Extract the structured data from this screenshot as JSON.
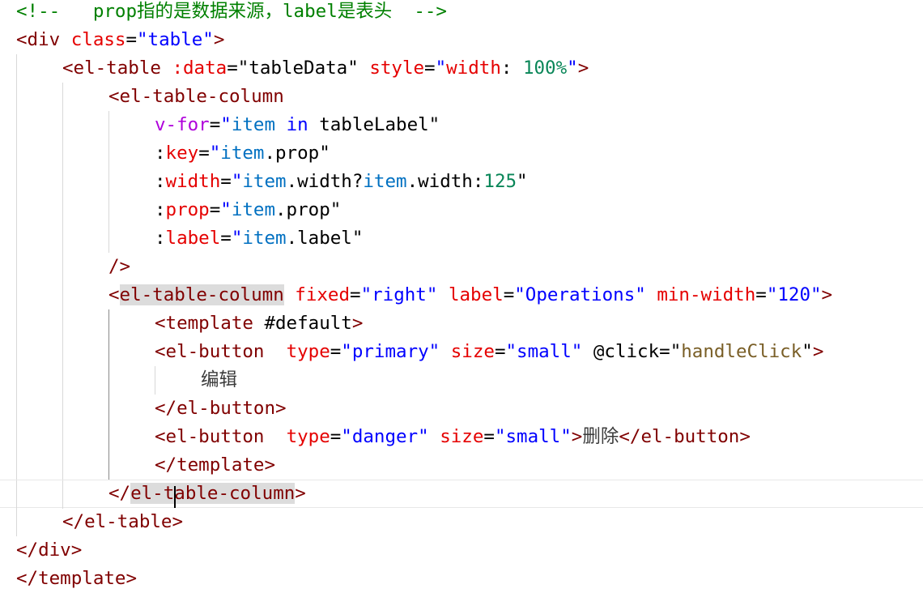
{
  "editor": {
    "lines": [
      {
        "indent": 0,
        "guides": [],
        "tokens": [
          {
            "t": "<!--",
            "c": "comment"
          },
          {
            "t": "   prop指的是数据来源，label是表头",
            "c": "comment"
          },
          {
            "t": "  -->",
            "c": "comment"
          }
        ]
      },
      {
        "indent": 0,
        "guides": [],
        "tokens": [
          {
            "t": "<",
            "c": "punct"
          },
          {
            "t": "div",
            "c": "tag"
          },
          {
            "t": " ",
            "c": "plain"
          },
          {
            "t": "class",
            "c": "attr"
          },
          {
            "t": "=",
            "c": "plain"
          },
          {
            "t": "\"table\"",
            "c": "str"
          },
          {
            "t": ">",
            "c": "punct"
          }
        ]
      },
      {
        "indent": 2,
        "guides": [
          0
        ],
        "tokens": [
          {
            "t": "<",
            "c": "punct"
          },
          {
            "t": "el-table",
            "c": "tag"
          },
          {
            "t": " ",
            "c": "plain"
          },
          {
            "t": ":data",
            "c": "attr"
          },
          {
            "t": "=",
            "c": "plain"
          },
          {
            "t": "\"tableData\"",
            "c": "plain"
          },
          {
            "t": " ",
            "c": "plain"
          },
          {
            "t": "style",
            "c": "attr"
          },
          {
            "t": "=",
            "c": "plain"
          },
          {
            "t": "\"",
            "c": "str"
          },
          {
            "t": "width",
            "c": "attr"
          },
          {
            "t": ": ",
            "c": "plain"
          },
          {
            "t": "100%",
            "c": "num"
          },
          {
            "t": "\"",
            "c": "str"
          },
          {
            "t": ">",
            "c": "punct"
          }
        ]
      },
      {
        "indent": 4,
        "guides": [
          0,
          2
        ],
        "tokens": [
          {
            "t": "<",
            "c": "punct"
          },
          {
            "t": "el-table-column",
            "c": "tag"
          }
        ]
      },
      {
        "indent": 6,
        "guides": [
          0,
          2,
          4
        ],
        "tokens": [
          {
            "t": "v-for",
            "c": "dir"
          },
          {
            "t": "=",
            "c": "plain"
          },
          {
            "t": "\"",
            "c": "str"
          },
          {
            "t": "item",
            "c": "var"
          },
          {
            "t": " ",
            "c": "plain"
          },
          {
            "t": "in",
            "c": "kw"
          },
          {
            "t": " tableLabel",
            "c": "plain"
          },
          {
            "t": "\"",
            "c": "plain"
          }
        ]
      },
      {
        "indent": 6,
        "guides": [
          0,
          2,
          4
        ],
        "tokens": [
          {
            "t": ":",
            "c": "plain"
          },
          {
            "t": "key",
            "c": "attr"
          },
          {
            "t": "=",
            "c": "plain"
          },
          {
            "t": "\"",
            "c": "str"
          },
          {
            "t": "item",
            "c": "var"
          },
          {
            "t": ".prop",
            "c": "plain"
          },
          {
            "t": "\"",
            "c": "plain"
          }
        ]
      },
      {
        "indent": 6,
        "guides": [
          0,
          2,
          4
        ],
        "tokens": [
          {
            "t": ":",
            "c": "plain"
          },
          {
            "t": "width",
            "c": "attr"
          },
          {
            "t": "=",
            "c": "plain"
          },
          {
            "t": "\"",
            "c": "str"
          },
          {
            "t": "item",
            "c": "var"
          },
          {
            "t": ".width?",
            "c": "plain"
          },
          {
            "t": "item",
            "c": "var"
          },
          {
            "t": ".width:",
            "c": "plain"
          },
          {
            "t": "125",
            "c": "num"
          },
          {
            "t": "\"",
            "c": "plain"
          }
        ]
      },
      {
        "indent": 6,
        "guides": [
          0,
          2,
          4
        ],
        "tokens": [
          {
            "t": ":",
            "c": "plain"
          },
          {
            "t": "prop",
            "c": "attr"
          },
          {
            "t": "=",
            "c": "plain"
          },
          {
            "t": "\"",
            "c": "str"
          },
          {
            "t": "item",
            "c": "var"
          },
          {
            "t": ".prop",
            "c": "plain"
          },
          {
            "t": "\"",
            "c": "plain"
          }
        ]
      },
      {
        "indent": 6,
        "guides": [
          0,
          2,
          4
        ],
        "tokens": [
          {
            "t": ":",
            "c": "plain"
          },
          {
            "t": "label",
            "c": "attr"
          },
          {
            "t": "=",
            "c": "plain"
          },
          {
            "t": "\"",
            "c": "str"
          },
          {
            "t": "item",
            "c": "var"
          },
          {
            "t": ".label",
            "c": "plain"
          },
          {
            "t": "\"",
            "c": "plain"
          }
        ]
      },
      {
        "indent": 4,
        "guides": [
          0,
          2
        ],
        "tokens": [
          {
            "t": "/>",
            "c": "punct"
          }
        ]
      },
      {
        "indent": 4,
        "guides": [
          0,
          2
        ],
        "tokens": [
          {
            "t": "<",
            "c": "punct"
          },
          {
            "t": "el-table-column",
            "c": "tag",
            "hl": true
          },
          {
            "t": " ",
            "c": "plain"
          },
          {
            "t": "fixed",
            "c": "attr"
          },
          {
            "t": "=",
            "c": "plain"
          },
          {
            "t": "\"right\"",
            "c": "str"
          },
          {
            "t": " ",
            "c": "plain"
          },
          {
            "t": "label",
            "c": "attr"
          },
          {
            "t": "=",
            "c": "plain"
          },
          {
            "t": "\"Operations\"",
            "c": "str"
          },
          {
            "t": " ",
            "c": "plain"
          },
          {
            "t": "min-width",
            "c": "attr"
          },
          {
            "t": "=",
            "c": "plain"
          },
          {
            "t": "\"120\"",
            "c": "str"
          },
          {
            "t": ">",
            "c": "punct"
          }
        ]
      },
      {
        "indent": 6,
        "guides": [
          0,
          2,
          4
        ],
        "active": 4,
        "tokens": [
          {
            "t": "<",
            "c": "punct"
          },
          {
            "t": "template",
            "c": "tag"
          },
          {
            "t": " #default",
            "c": "plain"
          },
          {
            "t": ">",
            "c": "punct"
          }
        ]
      },
      {
        "indent": 6,
        "guides": [
          0,
          2,
          4
        ],
        "active": 4,
        "tokens": [
          {
            "t": "<",
            "c": "punct"
          },
          {
            "t": "el-button",
            "c": "tag"
          },
          {
            "t": "  ",
            "c": "plain"
          },
          {
            "t": "type",
            "c": "attr"
          },
          {
            "t": "=",
            "c": "plain"
          },
          {
            "t": "\"primary\"",
            "c": "str"
          },
          {
            "t": " ",
            "c": "plain"
          },
          {
            "t": "size",
            "c": "attr"
          },
          {
            "t": "=",
            "c": "plain"
          },
          {
            "t": "\"small\"",
            "c": "str"
          },
          {
            "t": " ",
            "c": "plain"
          },
          {
            "t": "@click",
            "c": "plain"
          },
          {
            "t": "=",
            "c": "plain"
          },
          {
            "t": "\"",
            "c": "plain"
          },
          {
            "t": "handleClick",
            "c": "fn"
          },
          {
            "t": "\"",
            "c": "plain"
          },
          {
            "t": ">",
            "c": "punct"
          }
        ]
      },
      {
        "indent": 8,
        "guides": [
          0,
          2,
          4,
          6
        ],
        "active": 4,
        "tokens": [
          {
            "t": "编辑",
            "c": "text"
          }
        ]
      },
      {
        "indent": 6,
        "guides": [
          0,
          2,
          4
        ],
        "active": 4,
        "tokens": [
          {
            "t": "</",
            "c": "punct"
          },
          {
            "t": "el-button",
            "c": "tag"
          },
          {
            "t": ">",
            "c": "punct"
          }
        ]
      },
      {
        "indent": 6,
        "guides": [
          0,
          2,
          4
        ],
        "active": 4,
        "tokens": [
          {
            "t": "<",
            "c": "punct"
          },
          {
            "t": "el-button",
            "c": "tag"
          },
          {
            "t": "  ",
            "c": "plain"
          },
          {
            "t": "type",
            "c": "attr"
          },
          {
            "t": "=",
            "c": "plain"
          },
          {
            "t": "\"danger\"",
            "c": "str"
          },
          {
            "t": " ",
            "c": "plain"
          },
          {
            "t": "size",
            "c": "attr"
          },
          {
            "t": "=",
            "c": "plain"
          },
          {
            "t": "\"small\"",
            "c": "str"
          },
          {
            "t": ">",
            "c": "punct"
          },
          {
            "t": "删除",
            "c": "text"
          },
          {
            "t": "</",
            "c": "punct"
          },
          {
            "t": "el-button",
            "c": "tag"
          },
          {
            "t": ">",
            "c": "punct"
          }
        ]
      },
      {
        "indent": 6,
        "guides": [
          0,
          2,
          4
        ],
        "active": 4,
        "tokens": [
          {
            "t": "</",
            "c": "punct"
          },
          {
            "t": "template",
            "c": "tag"
          },
          {
            "t": ">",
            "c": "punct"
          }
        ]
      },
      {
        "indent": 4,
        "guides": [
          0,
          2
        ],
        "current": true,
        "tokens": [
          {
            "t": "</",
            "c": "punct"
          },
          {
            "t": "el-t",
            "c": "tag",
            "hl": true
          },
          {
            "t": "able-column",
            "c": "tag",
            "hl": true,
            "cursor": true
          },
          {
            "t": ">",
            "c": "punct"
          }
        ]
      },
      {
        "indent": 2,
        "guides": [
          0
        ],
        "tokens": [
          {
            "t": "</",
            "c": "punct"
          },
          {
            "t": "el-table",
            "c": "tag"
          },
          {
            "t": ">",
            "c": "punct"
          }
        ]
      },
      {
        "indent": 0,
        "guides": [],
        "tokens": [
          {
            "t": "</",
            "c": "punct"
          },
          {
            "t": "div",
            "c": "tag"
          },
          {
            "t": ">",
            "c": "punct"
          }
        ]
      },
      {
        "indent": 0,
        "guides": [],
        "tokens": [
          {
            "t": "</",
            "c": "punct"
          },
          {
            "t": "template",
            "c": "tag"
          },
          {
            "t": ">",
            "c": "punct"
          }
        ]
      }
    ]
  }
}
